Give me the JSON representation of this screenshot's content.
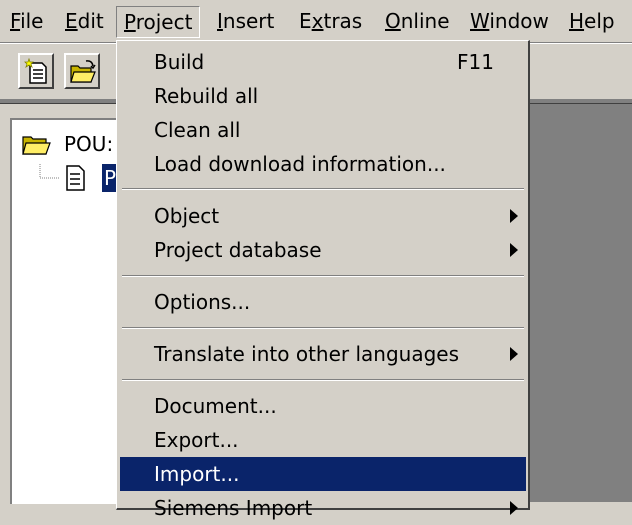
{
  "menubar": {
    "items": [
      {
        "label": "File",
        "mnemonic": "F"
      },
      {
        "label": "Edit",
        "mnemonic": "E"
      },
      {
        "label": "Project",
        "mnemonic": "P"
      },
      {
        "label": "Insert",
        "mnemonic": "I"
      },
      {
        "label": "Extras",
        "mnemonic": "x"
      },
      {
        "label": "Online",
        "mnemonic": "O"
      },
      {
        "label": "Window",
        "mnemonic": "W"
      },
      {
        "label": "Help",
        "mnemonic": "H"
      }
    ]
  },
  "toolbar": {
    "buttons": [
      {
        "icon": "new-document-icon"
      },
      {
        "icon": "open-folder-icon"
      }
    ]
  },
  "tree": {
    "root_label": "POU:",
    "child_label": "P"
  },
  "project_menu": {
    "items": [
      {
        "label": "Build",
        "shortcut": "F11"
      },
      {
        "label": "Rebuild all"
      },
      {
        "label": "Clean all"
      },
      {
        "label": "Load download information..."
      },
      {
        "label": "Object",
        "submenu": true
      },
      {
        "label": "Project database",
        "submenu": true
      },
      {
        "label": "Options..."
      },
      {
        "label": "Translate into other languages",
        "submenu": true
      },
      {
        "label": "Document..."
      },
      {
        "label": "Export..."
      },
      {
        "label": "Import...",
        "highlighted": true
      },
      {
        "label": "Siemens Import",
        "submenu": true
      }
    ]
  },
  "colors": {
    "face": "#d4d0c8",
    "highlight": "#0a246a",
    "workspace": "#808080"
  }
}
